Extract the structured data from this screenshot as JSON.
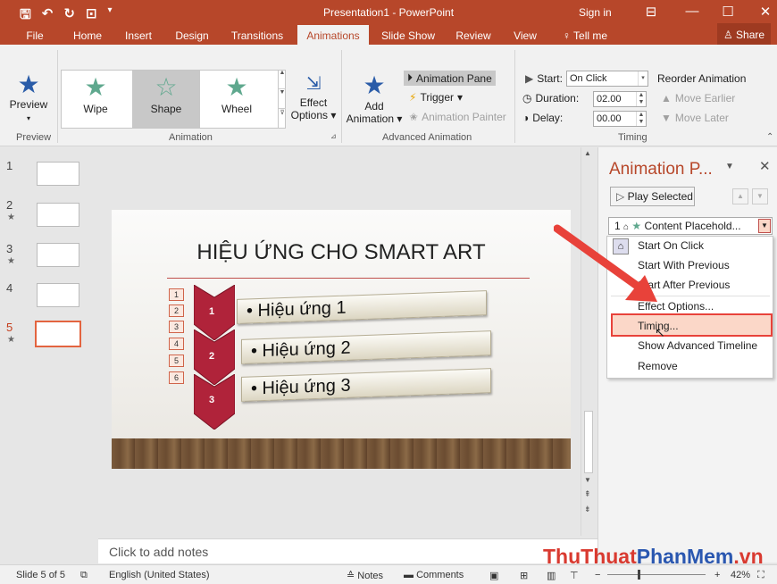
{
  "window": {
    "title": "Presentation1 - PowerPoint",
    "signin": "Sign in"
  },
  "tabs": [
    "File",
    "Home",
    "Insert",
    "Design",
    "Transitions",
    "Animations",
    "Slide Show",
    "Review",
    "View",
    "Tell me"
  ],
  "share": "Share",
  "ribbon": {
    "preview": {
      "label": "Preview",
      "group": "Preview"
    },
    "gallery": [
      {
        "label": "Wipe"
      },
      {
        "label": "Shape"
      },
      {
        "label": "Wheel"
      }
    ],
    "effect_options": {
      "l1": "Effect",
      "l2": "Options"
    },
    "animation_group": "Animation",
    "add_animation": {
      "l1": "Add",
      "l2": "Animation"
    },
    "animation_pane": "Animation Pane",
    "trigger": "Trigger",
    "animation_painter": "Animation Painter",
    "advanced_group": "Advanced Animation",
    "start_label": "Start:",
    "start_value": "On Click",
    "duration_label": "Duration:",
    "duration_value": "02.00",
    "delay_label": "Delay:",
    "delay_value": "00.00",
    "reorder": "Reorder Animation",
    "move_earlier": "Move Earlier",
    "move_later": "Move Later",
    "timing_group": "Timing"
  },
  "slides": [
    {
      "num": "1",
      "star": ""
    },
    {
      "num": "2",
      "star": "★"
    },
    {
      "num": "3",
      "star": "★"
    },
    {
      "num": "4",
      "star": ""
    },
    {
      "num": "5",
      "star": "★"
    }
  ],
  "slide": {
    "title": "HIỆU ỨNG CHO SMART ART",
    "numbers": [
      "1",
      "2",
      "3",
      "4",
      "5",
      "6"
    ],
    "items": [
      {
        "n": "1",
        "text": "• Hiệu ứng 1"
      },
      {
        "n": "2",
        "text": "• Hiệu ứng 2"
      },
      {
        "n": "3",
        "text": "• Hiệu ứng 3"
      }
    ]
  },
  "notes_placeholder": "Click to add notes",
  "pane": {
    "title": "Animation P...",
    "play": "Play Selected",
    "row_num": "1",
    "row_text": "Content Placehold...",
    "menu": [
      "Start On Click",
      "Start With Previous",
      "Start After Previous",
      "Effect Options...",
      "Timing...",
      "Show Advanced Timeline",
      "Remove"
    ]
  },
  "status": {
    "slide": "Slide 5 of 5",
    "lang": "English (United States)",
    "notes": "Notes",
    "comments": "Comments",
    "zoom": "42%"
  },
  "watermark": {
    "a": "ThuThuat",
    "b": "PhanMem",
    "c": ".vn"
  },
  "colors": {
    "accent": "#b7472a",
    "highlight": "#e8423a"
  }
}
